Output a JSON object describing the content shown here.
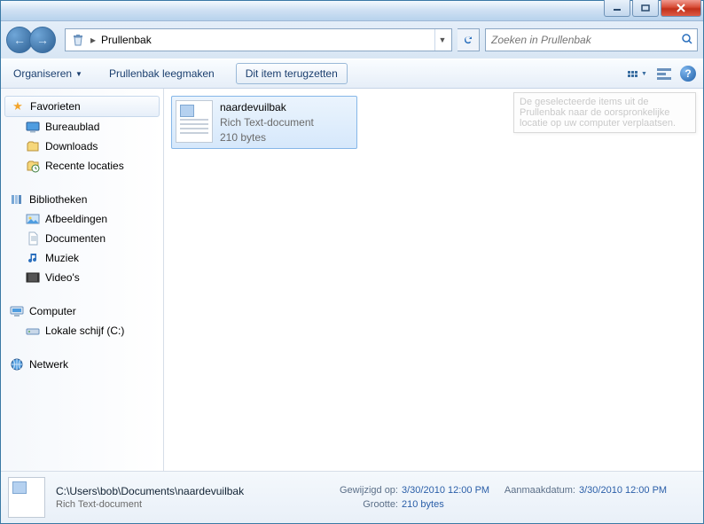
{
  "titlebar": {},
  "nav": {
    "location": "Prullenbak",
    "search_placeholder": "Zoeken in Prullenbak"
  },
  "toolbar": {
    "organize": "Organiseren",
    "empty": "Prullenbak leegmaken",
    "restore": "Dit item terugzetten"
  },
  "sidebar": {
    "fav_header": "Favorieten",
    "fav_items": [
      "Bureaublad",
      "Downloads",
      "Recente locaties"
    ],
    "lib_header": "Bibliotheken",
    "lib_items": [
      "Afbeeldingen",
      "Documenten",
      "Muziek",
      "Video's"
    ],
    "comp_header": "Computer",
    "comp_items": [
      "Lokale schijf (C:)"
    ],
    "net_header": "Netwerk"
  },
  "file": {
    "name": "naardevuilbak",
    "type": "Rich Text-document",
    "size": "210 bytes"
  },
  "tooltip": "De geselecteerde items uit de Prullenbak naar de oorspronkelijke locatie op uw computer verplaatsen.",
  "details": {
    "path": "C:\\Users\\bob\\Documents\\naardevuilbak",
    "type": "Rich Text-document",
    "modified_label": "Gewijzigd op:",
    "modified": "3/30/2010 12:00 PM",
    "size_label": "Grootte:",
    "size": "210 bytes",
    "created_label": "Aanmaakdatum:",
    "created": "3/30/2010 12:00 PM"
  }
}
